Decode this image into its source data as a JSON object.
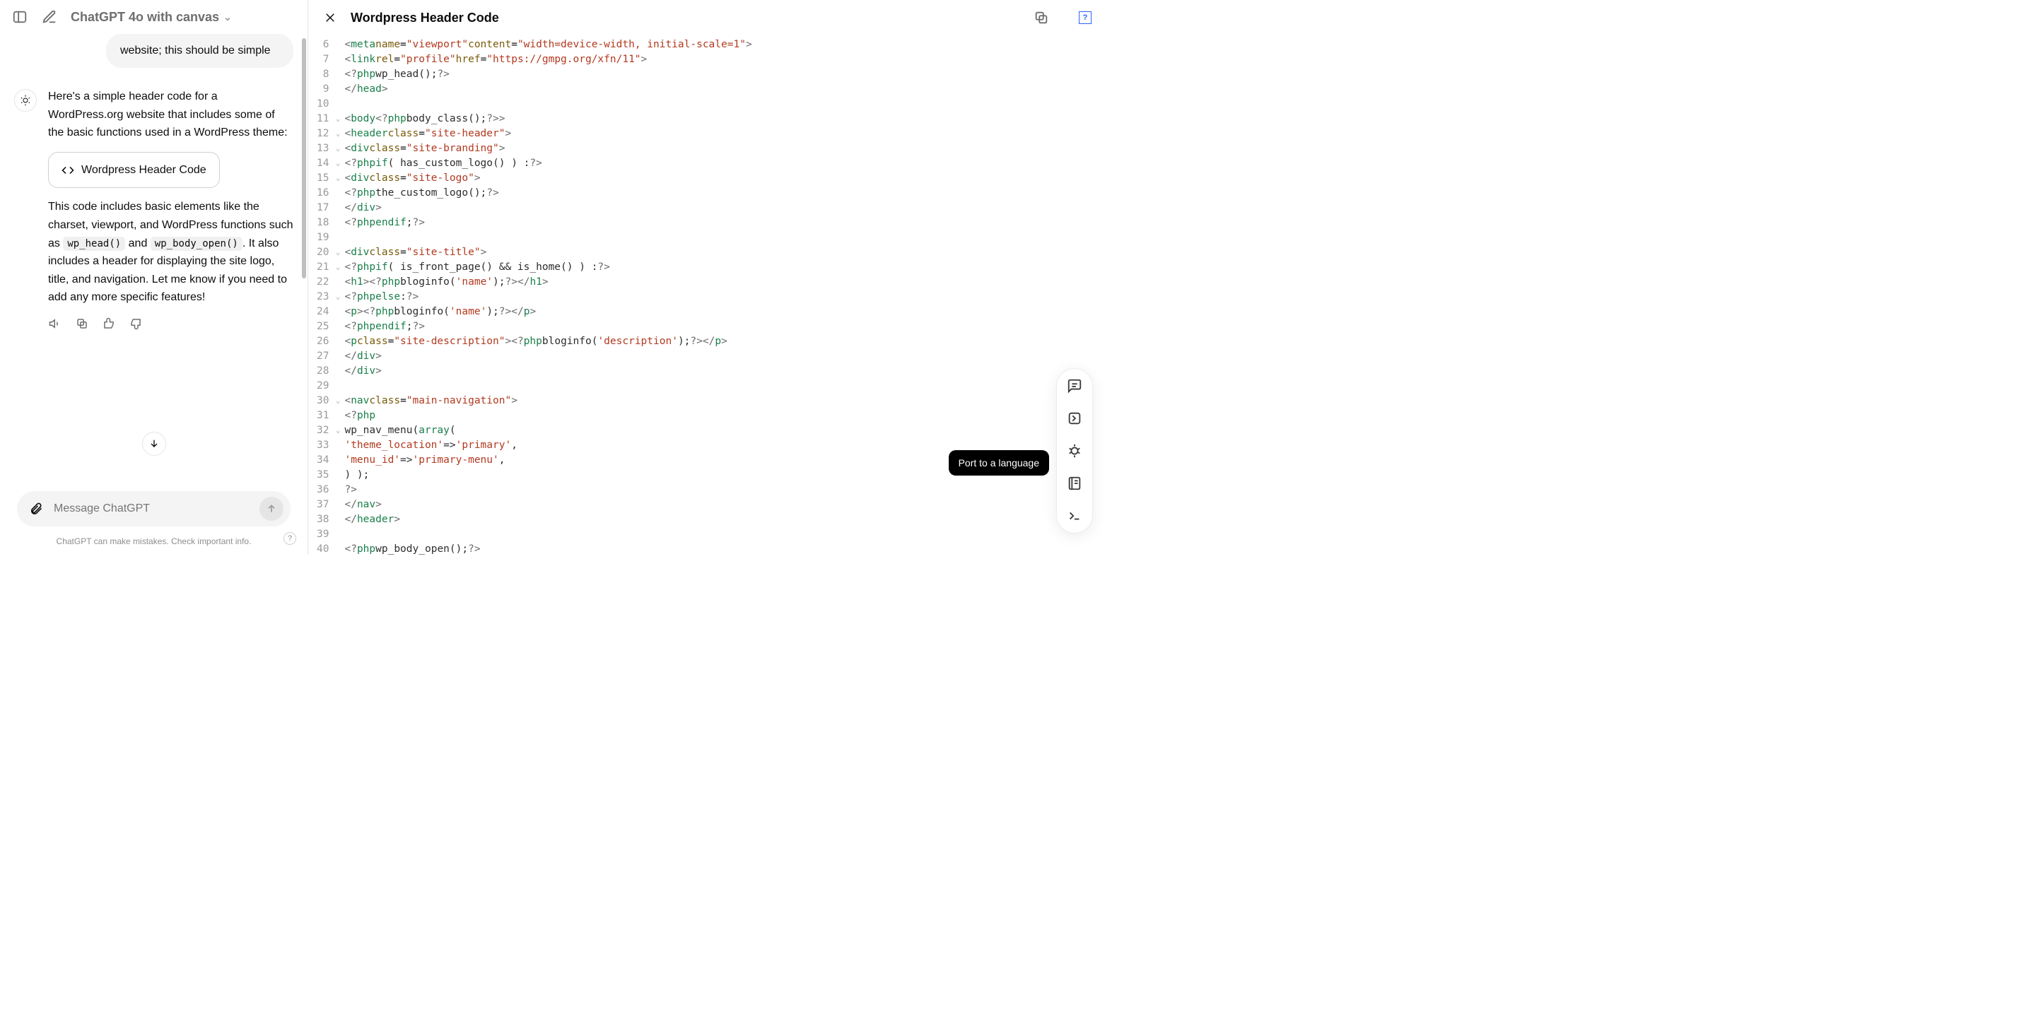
{
  "header": {
    "model_label": "ChatGPT 4o with canvas"
  },
  "conversation": {
    "user_message": "website; this should be simple",
    "assistant_intro": "Here's a simple header code for a WordPress.org website that includes some of the basic functions used in a WordPress theme:",
    "artifact_chip_label": "Wordpress Header Code",
    "assistant_followup_pre": "This code includes basic elements like the charset, viewport, and WordPress functions such as ",
    "code_inline_1": "wp_head()",
    "between_codes": " and ",
    "code_inline_2": "wp_body_open()",
    "assistant_followup_post": ". It also includes a header for displaying the site logo, title, and navigation. Let me know if you need to add any more specific features!"
  },
  "composer": {
    "placeholder": "Message ChatGPT"
  },
  "disclaimer": "ChatGPT can make mistakes. Check important info.",
  "canvas": {
    "title": "Wordpress Header Code",
    "version_badge": "?",
    "tooltip": "Port to a language",
    "code_lines": [
      {
        "n": 6,
        "fold": false,
        "html": "        <span class='pdelim'>&lt;</span><span class='tag'>meta</span> <span class='attr'>name</span>=<span class='str'>\"viewport\"</span> <span class='attr'>content</span>=<span class='str'>\"width=device-width, initial-scale=1\"</span><span class='pdelim'>&gt;</span>"
      },
      {
        "n": 7,
        "fold": false,
        "html": "        <span class='pdelim'>&lt;</span><span class='tag'>link</span> <span class='attr'>rel</span>=<span class='str'>\"profile\"</span> <span class='attr'>href</span>=<span class='str'>\"https://gmpg.org/xfn/11\"</span><span class='pdelim'>&gt;</span>"
      },
      {
        "n": 8,
        "fold": false,
        "html": "        <span class='pdelim'>&lt;?</span><span class='php'>php</span> <span class='txt'>wp_head();</span> <span class='pdelim'>?&gt;</span>"
      },
      {
        "n": 9,
        "fold": false,
        "html": "    <span class='pdelim'>&lt;/</span><span class='tag'>head</span><span class='pdelim'>&gt;</span>"
      },
      {
        "n": 10,
        "fold": false,
        "html": ""
      },
      {
        "n": 11,
        "fold": true,
        "html": "    <span class='pdelim'>&lt;</span><span class='tag'>body</span> <span class='pdelim'>&lt;?</span><span class='php'>php</span> <span class='txt'>body_class();</span> <span class='pdelim'>?&gt;</span><span class='pdelim'>&gt;</span>"
      },
      {
        "n": 12,
        "fold": true,
        "html": "        <span class='pdelim'>&lt;</span><span class='tag'>header</span> <span class='attr'>class</span>=<span class='str'>\"site-header\"</span><span class='pdelim'>&gt;</span>"
      },
      {
        "n": 13,
        "fold": true,
        "html": "            <span class='pdelim'>&lt;</span><span class='tag'>div</span> <span class='attr'>class</span>=<span class='str'>\"site-branding\"</span><span class='pdelim'>&gt;</span>"
      },
      {
        "n": 14,
        "fold": true,
        "html": "                <span class='pdelim'>&lt;?</span><span class='php'>php</span> <span class='tag'>if</span> <span class='txt'>( has_custom_logo() ) :</span> <span class='pdelim'>?&gt;</span>"
      },
      {
        "n": 15,
        "fold": true,
        "html": "                    <span class='pdelim'>&lt;</span><span class='tag'>div</span> <span class='attr'>class</span>=<span class='str'>\"site-logo\"</span><span class='pdelim'>&gt;</span>"
      },
      {
        "n": 16,
        "fold": false,
        "html": "                        <span class='pdelim'>&lt;?</span><span class='php'>php</span> <span class='txt'>the_custom_logo();</span> <span class='pdelim'>?&gt;</span>"
      },
      {
        "n": 17,
        "fold": false,
        "html": "                    <span class='pdelim'>&lt;/</span><span class='tag'>div</span><span class='pdelim'>&gt;</span>"
      },
      {
        "n": 18,
        "fold": false,
        "html": "                <span class='pdelim'>&lt;?</span><span class='php'>php</span> <span class='tag'>endif</span><span class='txt'>;</span> <span class='pdelim'>?&gt;</span>"
      },
      {
        "n": 19,
        "fold": false,
        "html": ""
      },
      {
        "n": 20,
        "fold": true,
        "html": "                <span class='pdelim'>&lt;</span><span class='tag'>div</span> <span class='attr'>class</span>=<span class='str'>\"site-title\"</span><span class='pdelim'>&gt;</span>"
      },
      {
        "n": 21,
        "fold": true,
        "html": "                    <span class='pdelim'>&lt;?</span><span class='php'>php</span> <span class='tag'>if</span> <span class='txt'>( is_front_page() &amp;&amp; is_home() ) :</span> <span class='pdelim'>?&gt;</span>"
      },
      {
        "n": 22,
        "fold": false,
        "html": "                        <span class='pdelim'>&lt;</span><span class='tag'>h1</span><span class='pdelim'>&gt;&lt;?</span><span class='php'>php</span> <span class='txt'>bloginfo(</span> <span class='str'>'name'</span> <span class='txt'>);</span> <span class='pdelim'>?&gt;&lt;/</span><span class='tag'>h1</span><span class='pdelim'>&gt;</span>"
      },
      {
        "n": 23,
        "fold": true,
        "html": "                    <span class='pdelim'>&lt;?</span><span class='php'>php</span> <span class='tag'>else</span> <span class='txt'>:</span> <span class='pdelim'>?&gt;</span>"
      },
      {
        "n": 24,
        "fold": false,
        "html": "                        <span class='pdelim'>&lt;</span><span class='tag'>p</span><span class='pdelim'>&gt;&lt;?</span><span class='php'>php</span> <span class='txt'>bloginfo(</span> <span class='str'>'name'</span> <span class='txt'>);</span> <span class='pdelim'>?&gt;&lt;/</span><span class='tag'>p</span><span class='pdelim'>&gt;</span>"
      },
      {
        "n": 25,
        "fold": false,
        "html": "                    <span class='pdelim'>&lt;?</span><span class='php'>php</span> <span class='tag'>endif</span><span class='txt'>;</span> <span class='pdelim'>?&gt;</span>"
      },
      {
        "n": 26,
        "fold": false,
        "html": "                    <span class='pdelim'>&lt;</span><span class='tag'>p</span> <span class='attr'>class</span>=<span class='str'>\"site-description\"</span><span class='pdelim'>&gt;&lt;?</span><span class='php'>php</span> <span class='txt'>bloginfo(</span> <span class='str'>'description'</span> <span class='txt'>);</span> <span class='pdelim'>?&gt;&lt;/</span><span class='tag'>p</span><span class='pdelim'>&gt;</span>"
      },
      {
        "n": 27,
        "fold": false,
        "html": "                <span class='pdelim'>&lt;/</span><span class='tag'>div</span><span class='pdelim'>&gt;</span>"
      },
      {
        "n": 28,
        "fold": false,
        "html": "            <span class='pdelim'>&lt;/</span><span class='tag'>div</span><span class='pdelim'>&gt;</span>"
      },
      {
        "n": 29,
        "fold": false,
        "html": ""
      },
      {
        "n": 30,
        "fold": true,
        "html": "            <span class='pdelim'>&lt;</span><span class='tag'>nav</span> <span class='attr'>class</span>=<span class='str'>\"main-navigation\"</span><span class='pdelim'>&gt;</span>"
      },
      {
        "n": 31,
        "fold": false,
        "html": "                <span class='pdelim'>&lt;?</span><span class='php'>php</span>"
      },
      {
        "n": 32,
        "fold": true,
        "html": "                    <span class='txt'>wp_nav_menu(</span> <span class='tag'>array</span><span class='txt'>(</span>"
      },
      {
        "n": 33,
        "fold": false,
        "html": "                        <span class='str'>'theme_location'</span> <span class='txt'>=&gt;</span> <span class='str'>'primary'</span><span class='txt'>,</span>"
      },
      {
        "n": 34,
        "fold": false,
        "html": "                        <span class='str'>'menu_id'</span>        <span class='txt'>=&gt;</span> <span class='str'>'primary-menu'</span><span class='txt'>,</span>"
      },
      {
        "n": 35,
        "fold": false,
        "html": "                    <span class='txt'>) );</span>"
      },
      {
        "n": 36,
        "fold": false,
        "html": "                <span class='pdelim'>?&gt;</span>"
      },
      {
        "n": 37,
        "fold": false,
        "html": "            <span class='pdelim'>&lt;/</span><span class='tag'>nav</span><span class='pdelim'>&gt;</span>"
      },
      {
        "n": 38,
        "fold": false,
        "html": "        <span class='pdelim'>&lt;/</span><span class='tag'>header</span><span class='pdelim'>&gt;</span>"
      },
      {
        "n": 39,
        "fold": false,
        "html": ""
      },
      {
        "n": 40,
        "fold": false,
        "html": "        <span class='pdelim'>&lt;?</span><span class='php'>php</span> <span class='txt'>wp_body_open();</span> <span class='pdelim'>?&gt;</span>"
      }
    ]
  }
}
